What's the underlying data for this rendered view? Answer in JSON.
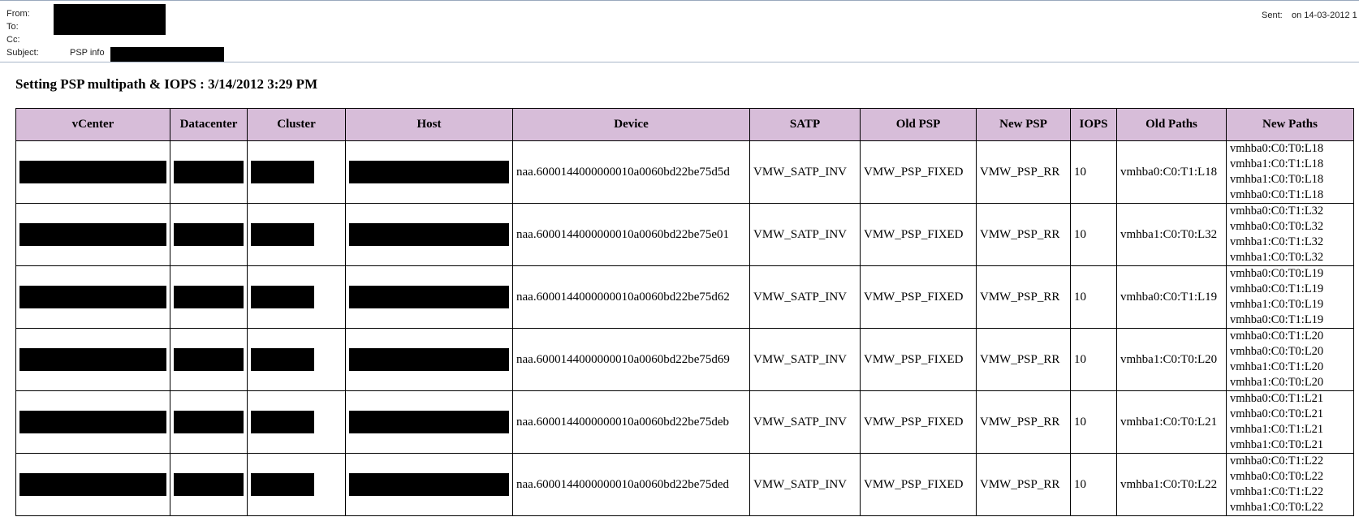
{
  "header": {
    "from_label": "From:",
    "to_label": "To:",
    "cc_label": "Cc:",
    "subject_label": "Subject:",
    "subject_text": "PSP info",
    "sent_label": "Sent:",
    "sent_value": "on 14-03-2012 1"
  },
  "report": {
    "title": "Setting PSP multipath & IOPS : 3/14/2012 3:29 PM"
  },
  "table": {
    "columns": [
      "vCenter",
      "Datacenter",
      "Cluster",
      "Host",
      "Device",
      "SATP",
      "Old PSP",
      "New PSP",
      "IOPS",
      "Old Paths",
      "New Paths"
    ],
    "rows": [
      {
        "device": "naa.6000144000000010a0060bd22be75d5d",
        "satp": "VMW_SATP_INV",
        "old_psp": "VMW_PSP_FIXED",
        "new_psp": "VMW_PSP_RR",
        "iops": "10",
        "old_paths": "vmhba0:C0:T1:L18",
        "new_paths": [
          "vmhba0:C0:T0:L18",
          "vmhba1:C0:T1:L18",
          "vmhba1:C0:T0:L18",
          "vmhba0:C0:T1:L18"
        ]
      },
      {
        "device": "naa.6000144000000010a0060bd22be75e01",
        "satp": "VMW_SATP_INV",
        "old_psp": "VMW_PSP_FIXED",
        "new_psp": "VMW_PSP_RR",
        "iops": "10",
        "old_paths": "vmhba1:C0:T0:L32",
        "new_paths": [
          "vmhba0:C0:T1:L32",
          "vmhba0:C0:T0:L32",
          "vmhba1:C0:T1:L32",
          "vmhba1:C0:T0:L32"
        ]
      },
      {
        "device": "naa.6000144000000010a0060bd22be75d62",
        "satp": "VMW_SATP_INV",
        "old_psp": "VMW_PSP_FIXED",
        "new_psp": "VMW_PSP_RR",
        "iops": "10",
        "old_paths": "vmhba0:C0:T1:L19",
        "new_paths": [
          "vmhba0:C0:T0:L19",
          "vmhba0:C0:T1:L19",
          "vmhba1:C0:T0:L19",
          "vmhba0:C0:T1:L19"
        ]
      },
      {
        "device": "naa.6000144000000010a0060bd22be75d69",
        "satp": "VMW_SATP_INV",
        "old_psp": "VMW_PSP_FIXED",
        "new_psp": "VMW_PSP_RR",
        "iops": "10",
        "old_paths": "vmhba1:C0:T0:L20",
        "new_paths": [
          "vmhba0:C0:T1:L20",
          "vmhba0:C0:T0:L20",
          "vmhba1:C0:T1:L20",
          "vmhba1:C0:T0:L20"
        ]
      },
      {
        "device": "naa.6000144000000010a0060bd22be75deb",
        "satp": "VMW_SATP_INV",
        "old_psp": "VMW_PSP_FIXED",
        "new_psp": "VMW_PSP_RR",
        "iops": "10",
        "old_paths": "vmhba1:C0:T0:L21",
        "new_paths": [
          "vmhba0:C0:T1:L21",
          "vmhba0:C0:T0:L21",
          "vmhba1:C0:T1:L21",
          "vmhba1:C0:T0:L21"
        ]
      },
      {
        "device": "naa.6000144000000010a0060bd22be75ded",
        "satp": "VMW_SATP_INV",
        "old_psp": "VMW_PSP_FIXED",
        "new_psp": "VMW_PSP_RR",
        "iops": "10",
        "old_paths": "vmhba1:C0:T0:L22",
        "new_paths": [
          "vmhba0:C0:T1:L22",
          "vmhba0:C0:T0:L22",
          "vmhba1:C0:T1:L22",
          "vmhba1:C0:T0:L22"
        ]
      }
    ]
  },
  "colors": {
    "header_fill": "#d7bdd9",
    "redaction": "#000000",
    "mail_header_border": "#a8b6c8"
  }
}
